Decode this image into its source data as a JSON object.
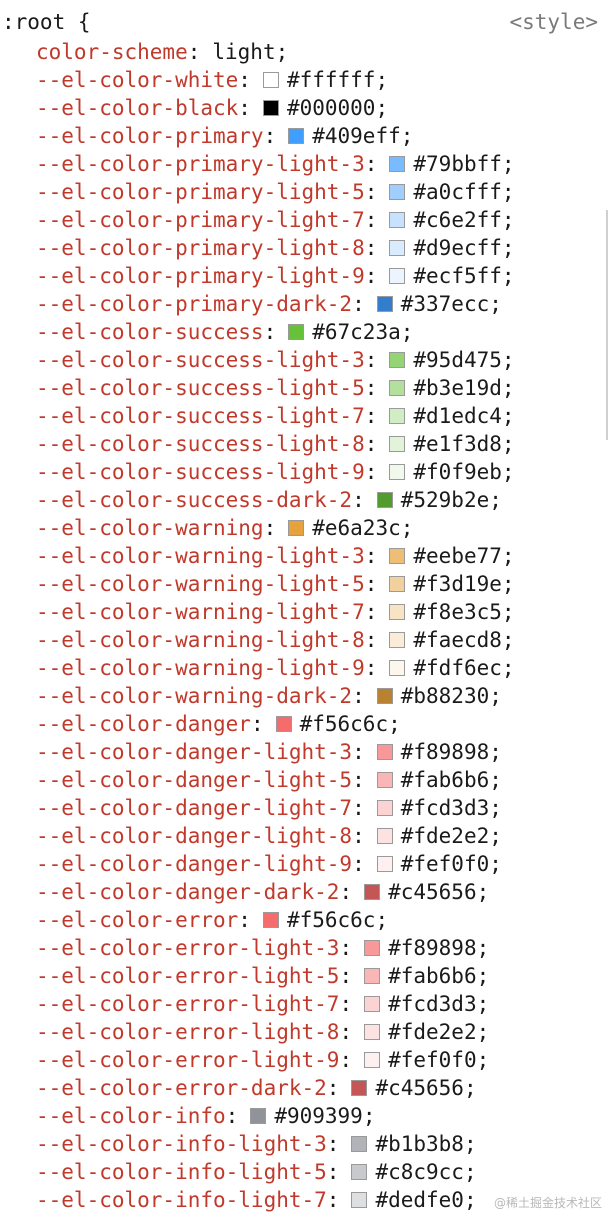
{
  "rule": {
    "selector_text": ":root {",
    "source_label": "<style>"
  },
  "declarations": [
    {
      "property": "color-scheme",
      "value": "light"
    },
    {
      "property": "--el-color-white",
      "value": "#ffffff",
      "swatch": "#ffffff"
    },
    {
      "property": "--el-color-black",
      "value": "#000000",
      "swatch": "#000000"
    },
    {
      "property": "--el-color-primary",
      "value": "#409eff",
      "swatch": "#409eff"
    },
    {
      "property": "--el-color-primary-light-3",
      "value": "#79bbff",
      "swatch": "#79bbff"
    },
    {
      "property": "--el-color-primary-light-5",
      "value": "#a0cfff",
      "swatch": "#a0cfff"
    },
    {
      "property": "--el-color-primary-light-7",
      "value": "#c6e2ff",
      "swatch": "#c6e2ff"
    },
    {
      "property": "--el-color-primary-light-8",
      "value": "#d9ecff",
      "swatch": "#d9ecff"
    },
    {
      "property": "--el-color-primary-light-9",
      "value": "#ecf5ff",
      "swatch": "#ecf5ff"
    },
    {
      "property": "--el-color-primary-dark-2",
      "value": "#337ecc",
      "swatch": "#337ecc"
    },
    {
      "property": "--el-color-success",
      "value": "#67c23a",
      "swatch": "#67c23a"
    },
    {
      "property": "--el-color-success-light-3",
      "value": "#95d475",
      "swatch": "#95d475"
    },
    {
      "property": "--el-color-success-light-5",
      "value": "#b3e19d",
      "swatch": "#b3e19d"
    },
    {
      "property": "--el-color-success-light-7",
      "value": "#d1edc4",
      "swatch": "#d1edc4"
    },
    {
      "property": "--el-color-success-light-8",
      "value": "#e1f3d8",
      "swatch": "#e1f3d8"
    },
    {
      "property": "--el-color-success-light-9",
      "value": "#f0f9eb",
      "swatch": "#f0f9eb"
    },
    {
      "property": "--el-color-success-dark-2",
      "value": "#529b2e",
      "swatch": "#529b2e"
    },
    {
      "property": "--el-color-warning",
      "value": "#e6a23c",
      "swatch": "#e6a23c"
    },
    {
      "property": "--el-color-warning-light-3",
      "value": "#eebe77",
      "swatch": "#eebe77"
    },
    {
      "property": "--el-color-warning-light-5",
      "value": "#f3d19e",
      "swatch": "#f3d19e"
    },
    {
      "property": "--el-color-warning-light-7",
      "value": "#f8e3c5",
      "swatch": "#f8e3c5"
    },
    {
      "property": "--el-color-warning-light-8",
      "value": "#faecd8",
      "swatch": "#faecd8"
    },
    {
      "property": "--el-color-warning-light-9",
      "value": "#fdf6ec",
      "swatch": "#fdf6ec"
    },
    {
      "property": "--el-color-warning-dark-2",
      "value": "#b88230",
      "swatch": "#b88230"
    },
    {
      "property": "--el-color-danger",
      "value": "#f56c6c",
      "swatch": "#f56c6c"
    },
    {
      "property": "--el-color-danger-light-3",
      "value": "#f89898",
      "swatch": "#f89898"
    },
    {
      "property": "--el-color-danger-light-5",
      "value": "#fab6b6",
      "swatch": "#fab6b6"
    },
    {
      "property": "--el-color-danger-light-7",
      "value": "#fcd3d3",
      "swatch": "#fcd3d3"
    },
    {
      "property": "--el-color-danger-light-8",
      "value": "#fde2e2",
      "swatch": "#fde2e2"
    },
    {
      "property": "--el-color-danger-light-9",
      "value": "#fef0f0",
      "swatch": "#fef0f0"
    },
    {
      "property": "--el-color-danger-dark-2",
      "value": "#c45656",
      "swatch": "#c45656"
    },
    {
      "property": "--el-color-error",
      "value": "#f56c6c",
      "swatch": "#f56c6c"
    },
    {
      "property": "--el-color-error-light-3",
      "value": "#f89898",
      "swatch": "#f89898"
    },
    {
      "property": "--el-color-error-light-5",
      "value": "#fab6b6",
      "swatch": "#fab6b6"
    },
    {
      "property": "--el-color-error-light-7",
      "value": "#fcd3d3",
      "swatch": "#fcd3d3"
    },
    {
      "property": "--el-color-error-light-8",
      "value": "#fde2e2",
      "swatch": "#fde2e2"
    },
    {
      "property": "--el-color-error-light-9",
      "value": "#fef0f0",
      "swatch": "#fef0f0"
    },
    {
      "property": "--el-color-error-dark-2",
      "value": "#c45656",
      "swatch": "#c45656"
    },
    {
      "property": "--el-color-info",
      "value": "#909399",
      "swatch": "#909399"
    },
    {
      "property": "--el-color-info-light-3",
      "value": "#b1b3b8",
      "swatch": "#b1b3b8"
    },
    {
      "property": "--el-color-info-light-5",
      "value": "#c8c9cc",
      "swatch": "#c8c9cc"
    },
    {
      "property": "--el-color-info-light-7",
      "value": "#dedfe0",
      "swatch": "#dedfe0"
    }
  ],
  "watermark": "@稀土掘金技术社区",
  "colors": {
    "property_name": "#c0392b",
    "text": "#1a1a1a",
    "source_link": "#7a7a7a"
  }
}
